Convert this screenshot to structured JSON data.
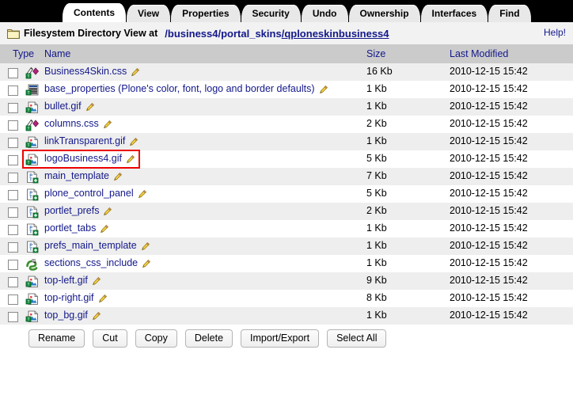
{
  "tabs": [
    {
      "label": "Contents",
      "active": true
    },
    {
      "label": "View",
      "active": false
    },
    {
      "label": "Properties",
      "active": false
    },
    {
      "label": "Security",
      "active": false
    },
    {
      "label": "Undo",
      "active": false
    },
    {
      "label": "Ownership",
      "active": false
    },
    {
      "label": "Interfaces",
      "active": false
    },
    {
      "label": "Find",
      "active": false
    }
  ],
  "header": {
    "title": "Filesystem Directory View at",
    "folder_icon": "folder-icon",
    "path_segments": [
      {
        "text": "/business4",
        "underlined": false
      },
      {
        "text": "/portal_skins",
        "underlined": false
      },
      {
        "text": "/qploneskinbusiness4",
        "underlined": true
      }
    ],
    "path_full": "/business4/portal_skins/qploneskinbusiness4",
    "help_label": "Help!"
  },
  "table": {
    "columns": [
      {
        "key": "type",
        "label": "Type",
        "sorted": false
      },
      {
        "key": "name",
        "label": "Name",
        "sorted": true
      },
      {
        "key": "size",
        "label": "Size",
        "sorted": false
      },
      {
        "key": "modified",
        "label": "Last Modified",
        "sorted": false
      }
    ],
    "rows": [
      {
        "name": "Business4Skin.css",
        "icon": "css-file-icon",
        "size": "16 Kb",
        "modified": "2010-12-15 15:42",
        "highlighted": false
      },
      {
        "name": "base_properties (Plone's color, font, logo and border defaults)",
        "icon": "properties-file-icon",
        "size": "1 Kb",
        "modified": "2010-12-15 15:42",
        "highlighted": false
      },
      {
        "name": "bullet.gif",
        "icon": "image-file-icon",
        "size": "1 Kb",
        "modified": "2010-12-15 15:42",
        "highlighted": false
      },
      {
        "name": "columns.css",
        "icon": "css-file-icon",
        "size": "2 Kb",
        "modified": "2010-12-15 15:42",
        "highlighted": false
      },
      {
        "name": "linkTransparent.gif",
        "icon": "image-file-icon",
        "size": "1 Kb",
        "modified": "2010-12-15 15:42",
        "highlighted": false
      },
      {
        "name": "logoBusiness4.gif",
        "icon": "image-file-icon",
        "size": "5 Kb",
        "modified": "2010-12-15 15:42",
        "highlighted": true
      },
      {
        "name": "main_template",
        "icon": "page-template-icon",
        "size": "7 Kb",
        "modified": "2010-12-15 15:42",
        "highlighted": false
      },
      {
        "name": "plone_control_panel",
        "icon": "page-template-icon",
        "size": "5 Kb",
        "modified": "2010-12-15 15:42",
        "highlighted": false
      },
      {
        "name": "portlet_prefs",
        "icon": "page-template-icon",
        "size": "2 Kb",
        "modified": "2010-12-15 15:42",
        "highlighted": false
      },
      {
        "name": "portlet_tabs",
        "icon": "page-template-icon",
        "size": "1 Kb",
        "modified": "2010-12-15 15:42",
        "highlighted": false
      },
      {
        "name": "prefs_main_template",
        "icon": "page-template-icon",
        "size": "1 Kb",
        "modified": "2010-12-15 15:42",
        "highlighted": false
      },
      {
        "name": "sections_css_include",
        "icon": "python-script-icon",
        "size": "1 Kb",
        "modified": "2010-12-15 15:42",
        "highlighted": false
      },
      {
        "name": "top-left.gif",
        "icon": "image-file-icon",
        "size": "9 Kb",
        "modified": "2010-12-15 15:42",
        "highlighted": false
      },
      {
        "name": "top-right.gif",
        "icon": "image-file-icon",
        "size": "8 Kb",
        "modified": "2010-12-15 15:42",
        "highlighted": false
      },
      {
        "name": "top_bg.gif",
        "icon": "image-file-icon",
        "size": "1 Kb",
        "modified": "2010-12-15 15:42",
        "highlighted": false
      }
    ]
  },
  "buttons": [
    {
      "label": "Rename",
      "name": "rename-button"
    },
    {
      "label": "Cut",
      "name": "cut-button"
    },
    {
      "label": "Copy",
      "name": "copy-button"
    },
    {
      "label": "Delete",
      "name": "delete-button"
    },
    {
      "label": "Import/Export",
      "name": "import-export-button"
    },
    {
      "label": "Select All",
      "name": "select-all-button"
    }
  ],
  "colors": {
    "link": "#13188a",
    "tabbar_bg": "#000000",
    "header_bg": "#f2f2f2",
    "table_header_bg": "#cbcbcb",
    "row_alt_bg": "#eeeeee",
    "highlight_box": "#ee0000"
  }
}
